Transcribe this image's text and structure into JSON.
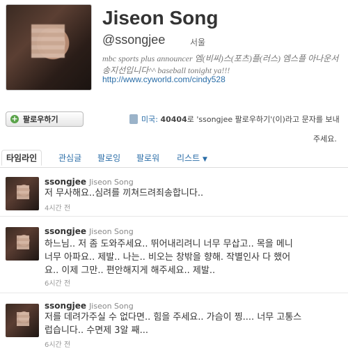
{
  "profile": {
    "name": "Jiseon Song",
    "handle": "@ssongjee",
    "location": "서울",
    "bio": "mbc sports plus announcer 엠(비씨)스(포츠)플(러스) 엠스플 아나운서 송지선입니다^^ baseball tonight ya!!!",
    "url": "http://www.cyworld.com/cindy528"
  },
  "follow": {
    "button_label": "팔로우하기",
    "sms_country": "미국:",
    "sms_code": "40404",
    "sms_mid": "로 'ssongjee 팔로우하기'",
    "sms_tail": "(이)라고 문자를 보내",
    "sms_tail2": "주세요."
  },
  "tabs": [
    "타임라인",
    "관심글",
    "팔로잉",
    "팔로워",
    "리스트"
  ],
  "tweets": [
    {
      "user": "ssongjee",
      "full_name": "Jiseon Song",
      "lines": [
        "저 무사해요..심려를 끼쳐드려죄송합니다.."
      ],
      "time": "4시간 전"
    },
    {
      "user": "ssongjee",
      "full_name": "Jiseon Song",
      "lines": [
        "하느님.. 저 좀 도와주세요.. 뛰어내리려니 너무 무삽고.. 목을 메니",
        "너무 아파요.. 제발.. 나는.. 비오는 창밖을 향해. 작별인사 다 했어",
        "요.. 이제 그만.. 편안해지게 해주세요.. 제발.."
      ],
      "time": "6시간 전"
    },
    {
      "user": "ssongjee",
      "full_name": "Jiseon Song",
      "lines": [
        "저를 데려가주실 수 없다면.. 힘을 주세요.. 가슴이 찡.... 너무 고통스",
        "럽습니다.. 수면제 3알 째..."
      ],
      "time": "6시간 전"
    }
  ]
}
